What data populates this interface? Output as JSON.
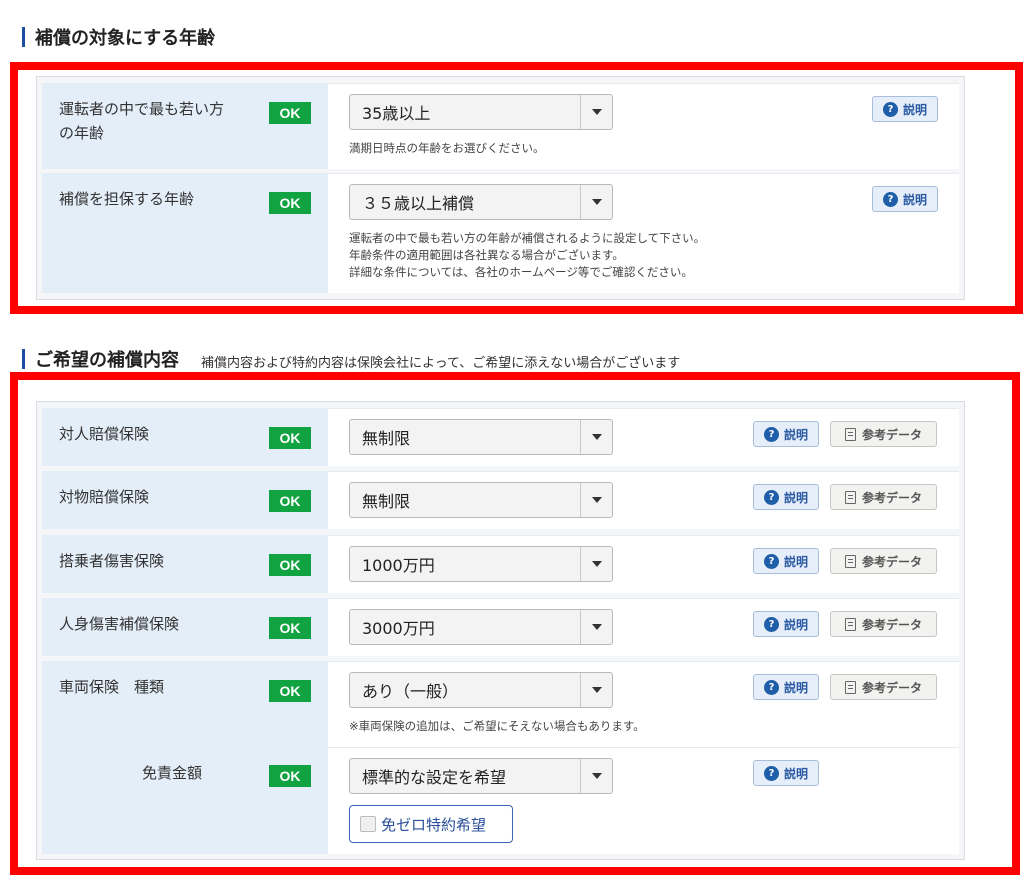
{
  "section1": {
    "title": "補償の対象にする年齢",
    "rows": [
      {
        "label": "運転者の中で最も若い方の年齢",
        "label_line1": "運転者の中で最も若い方",
        "label_line2": "の年齢",
        "status": "OK",
        "selected": "35歳以上",
        "hints": [
          "満期日時点の年齢をお選びください。"
        ],
        "explain_label": "説明"
      },
      {
        "label": "補償を担保する年齢",
        "status": "OK",
        "selected": "３５歳以上補償",
        "hints": [
          "運転者の中で最も若い方の年齢が補償されるように設定して下さい。",
          "年齢条件の適用範囲は各社異なる場合がございます。",
          "詳細な条件については、各社のホームページ等でご確認ください。"
        ],
        "explain_label": "説明"
      }
    ]
  },
  "section2": {
    "title": "ご希望の補償内容",
    "note": "補償内容および特約内容は保険会社によって、ご希望に添えない場合がございます",
    "rows": [
      {
        "label": "対人賠償保険",
        "status": "OK",
        "selected": "無制限",
        "explain_label": "説明",
        "ref_label": "参考データ"
      },
      {
        "label": "対物賠償保険",
        "status": "OK",
        "selected": "無制限",
        "explain_label": "説明",
        "ref_label": "参考データ"
      },
      {
        "label": "搭乗者傷害保険",
        "status": "OK",
        "selected": "1000万円",
        "explain_label": "説明",
        "ref_label": "参考データ"
      },
      {
        "label": "人身傷害補償保険",
        "status": "OK",
        "selected": "3000万円",
        "explain_label": "説明",
        "ref_label": "参考データ"
      },
      {
        "label": "車両保険　種類",
        "status": "OK",
        "selected": "あり（一般）",
        "hint": "※車両保険の追加は、ご希望にそえない場合もあります。",
        "explain_label": "説明",
        "ref_label": "参考データ"
      }
    ],
    "deductible": {
      "label": "免責金額",
      "status": "OK",
      "selected": "標準的な設定を希望",
      "explain_label": "説明",
      "checkbox_label": "免ゼロ特約希望"
    }
  },
  "icons": {
    "explain": "question-circle-icon",
    "reference": "document-icon",
    "dropdown": "caret-down-icon"
  },
  "colors": {
    "ok_badge": "#11a241",
    "highlight_frame": "#ff0000",
    "label_bg": "#e3eef9",
    "accent": "#1d4ea3"
  }
}
